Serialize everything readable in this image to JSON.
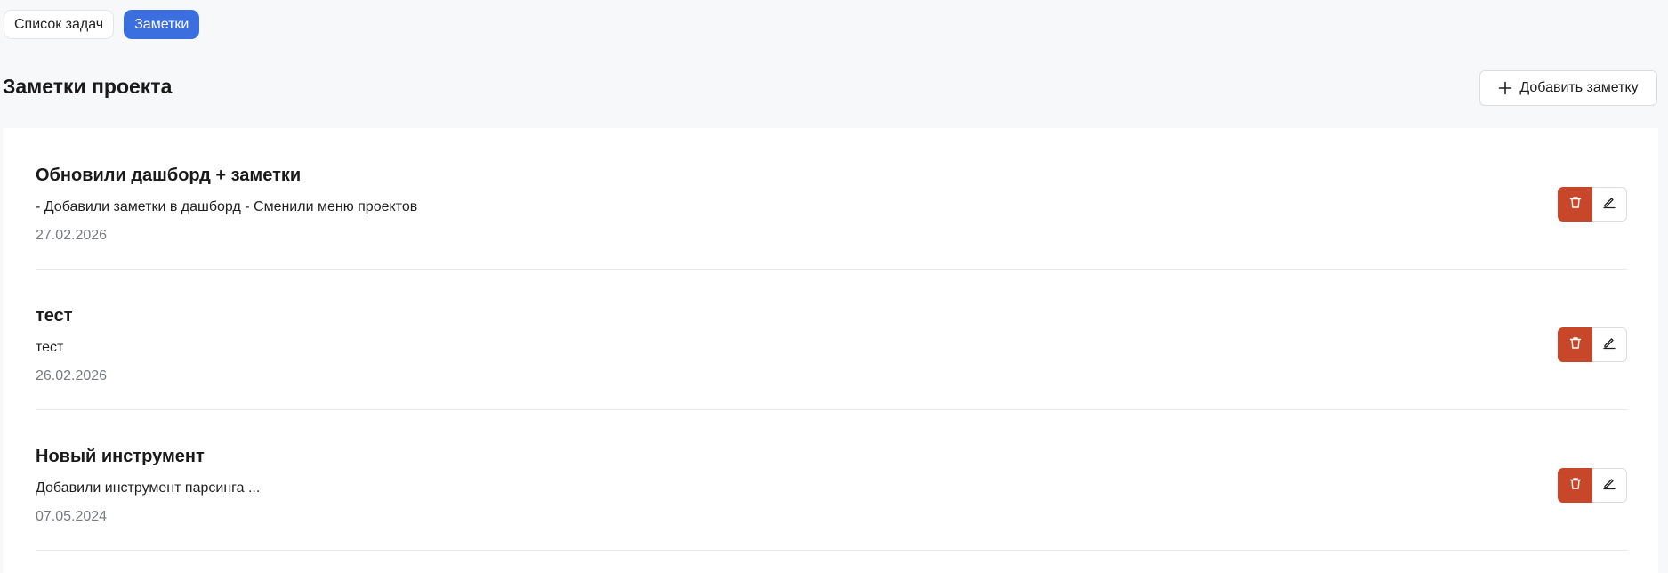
{
  "tabs": [
    {
      "label": "Список задач",
      "active": false
    },
    {
      "label": "Заметки",
      "active": true
    }
  ],
  "page": {
    "title": "Заметки проекта",
    "add_button_label": "Добавить заметку"
  },
  "notes": [
    {
      "title": "Обновили дашборд + заметки",
      "body": "- Добавили заметки в дашборд - Сменили меню проектов",
      "date": "27.02.2026"
    },
    {
      "title": "тест",
      "body": "тест",
      "date": "26.02.2026"
    },
    {
      "title": "Новый инструмент",
      "body": "Добавили инструмент парсинга ...",
      "date": "07.05.2024"
    }
  ],
  "icons": {
    "add": "plus-icon",
    "delete": "trash-icon",
    "edit": "pencil-icon"
  },
  "colors": {
    "accent": "#3b6fe0",
    "danger": "#c8472b",
    "background": "#f7f8fa",
    "card": "#ffffff",
    "muted_text": "#777b80"
  }
}
